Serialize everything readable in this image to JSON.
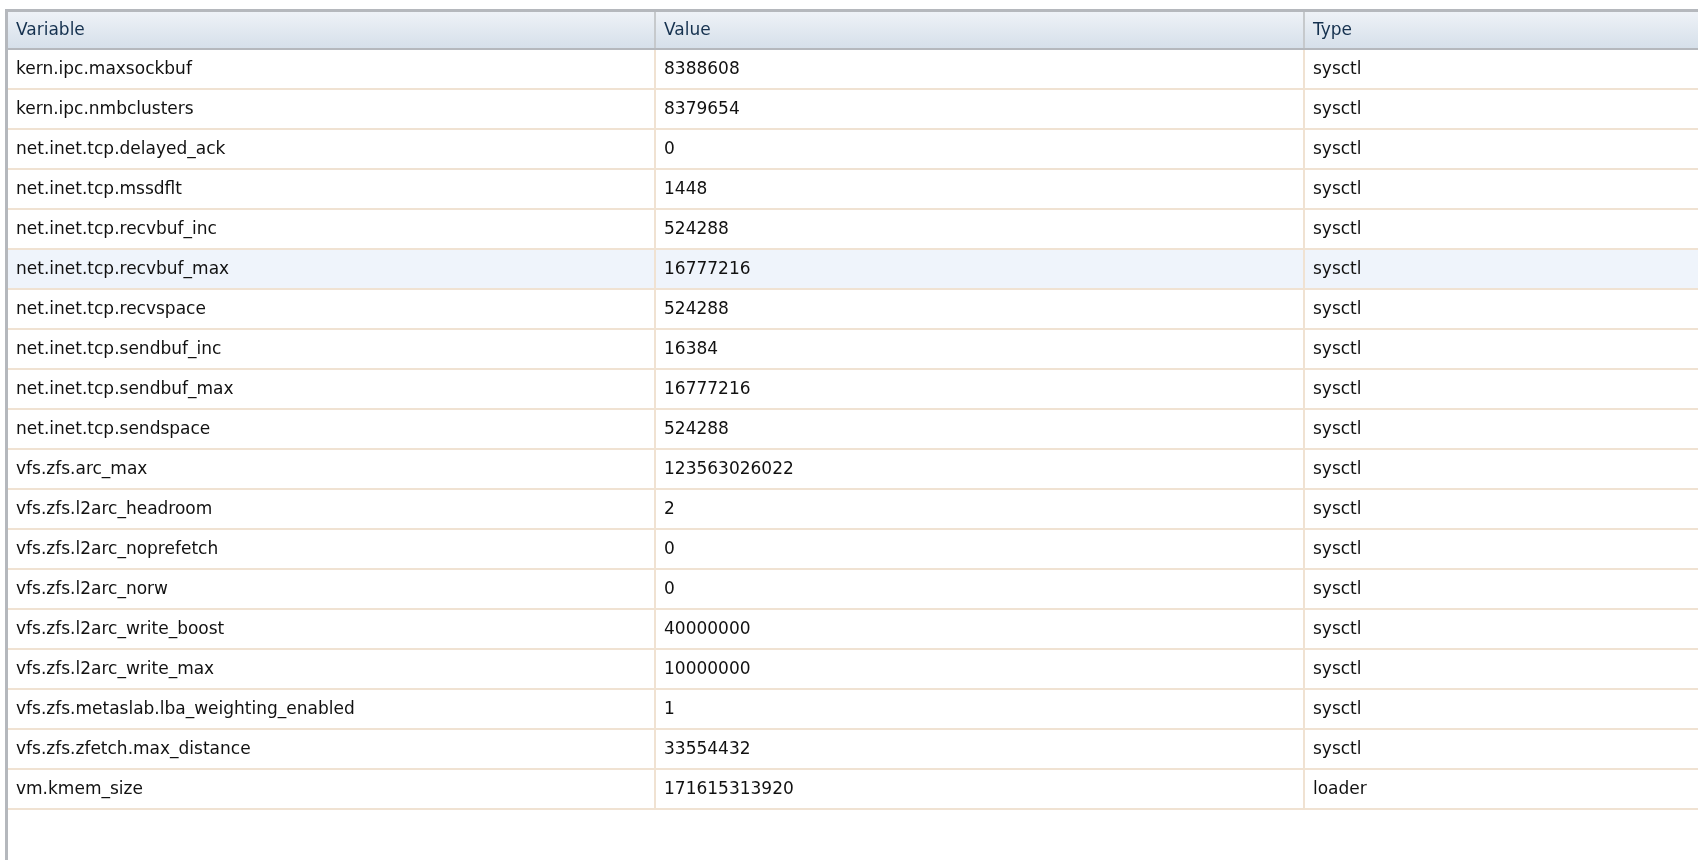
{
  "table": {
    "columns": [
      "Variable",
      "Value",
      "Type"
    ],
    "rows": [
      {
        "variable": "kern.ipc.maxsockbuf",
        "value": "8388608",
        "type": "sysctl",
        "selected": false
      },
      {
        "variable": "kern.ipc.nmbclusters",
        "value": "8379654",
        "type": "sysctl",
        "selected": false
      },
      {
        "variable": "net.inet.tcp.delayed_ack",
        "value": "0",
        "type": "sysctl",
        "selected": false
      },
      {
        "variable": "net.inet.tcp.mssdflt",
        "value": "1448",
        "type": "sysctl",
        "selected": false
      },
      {
        "variable": "net.inet.tcp.recvbuf_inc",
        "value": "524288",
        "type": "sysctl",
        "selected": false
      },
      {
        "variable": "net.inet.tcp.recvbuf_max",
        "value": "16777216",
        "type": "sysctl",
        "selected": true
      },
      {
        "variable": "net.inet.tcp.recvspace",
        "value": "524288",
        "type": "sysctl",
        "selected": false
      },
      {
        "variable": "net.inet.tcp.sendbuf_inc",
        "value": "16384",
        "type": "sysctl",
        "selected": false
      },
      {
        "variable": "net.inet.tcp.sendbuf_max",
        "value": "16777216",
        "type": "sysctl",
        "selected": false
      },
      {
        "variable": "net.inet.tcp.sendspace",
        "value": "524288",
        "type": "sysctl",
        "selected": false
      },
      {
        "variable": "vfs.zfs.arc_max",
        "value": "123563026022",
        "type": "sysctl",
        "selected": false
      },
      {
        "variable": "vfs.zfs.l2arc_headroom",
        "value": "2",
        "type": "sysctl",
        "selected": false
      },
      {
        "variable": "vfs.zfs.l2arc_noprefetch",
        "value": "0",
        "type": "sysctl",
        "selected": false
      },
      {
        "variable": "vfs.zfs.l2arc_norw",
        "value": "0",
        "type": "sysctl",
        "selected": false
      },
      {
        "variable": "vfs.zfs.l2arc_write_boost",
        "value": "40000000",
        "type": "sysctl",
        "selected": false
      },
      {
        "variable": "vfs.zfs.l2arc_write_max",
        "value": "10000000",
        "type": "sysctl",
        "selected": false
      },
      {
        "variable": "vfs.zfs.metaslab.lba_weighting_enabled",
        "value": "1",
        "type": "sysctl",
        "selected": false
      },
      {
        "variable": "vfs.zfs.zfetch.max_distance",
        "value": "33554432",
        "type": "sysctl",
        "selected": false
      },
      {
        "variable": "vm.kmem_size",
        "value": "171615313920",
        "type": "loader",
        "selected": false
      }
    ]
  }
}
